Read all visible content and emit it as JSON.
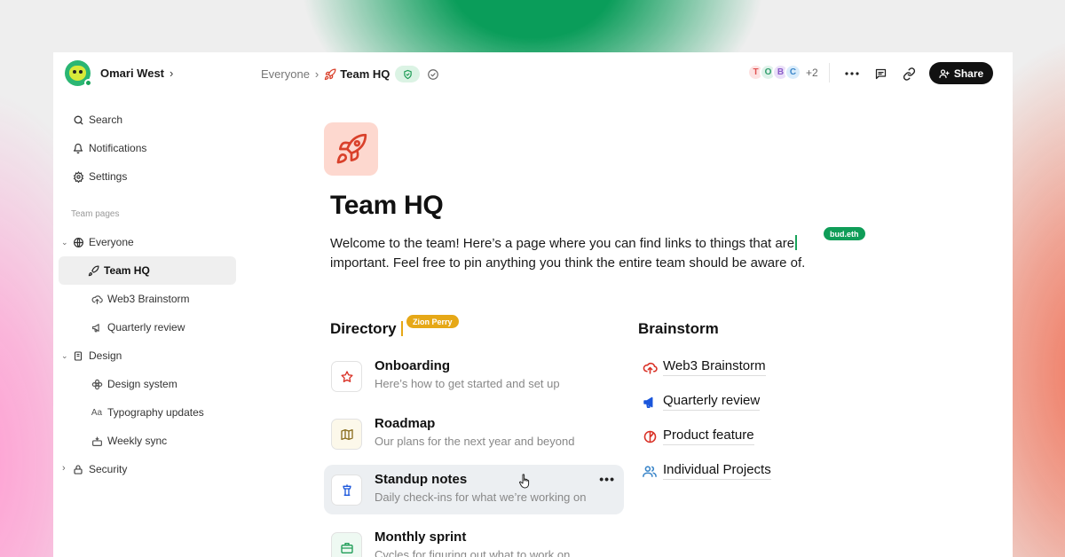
{
  "user": {
    "name": "Omari West"
  },
  "breadcrumb": {
    "parent": "Everyone",
    "current": "Team HQ"
  },
  "collaborators": {
    "avatars": [
      {
        "initial": "T",
        "bg": "#fde2e2",
        "fg": "#e05252"
      },
      {
        "initial": "O",
        "bg": "#dff2ea",
        "fg": "#2e9d6a"
      },
      {
        "initial": "B",
        "bg": "#eadff8",
        "fg": "#8b5cc9"
      },
      {
        "initial": "C",
        "bg": "#d9ecfb",
        "fg": "#3b86c9"
      }
    ],
    "more": "+2"
  },
  "toolbar": {
    "share_label": "Share"
  },
  "sidebar": {
    "search": "Search",
    "notifications": "Notifications",
    "settings": "Settings",
    "section_caption": "Team pages",
    "everyone": "Everyone",
    "team_hq": "Team HQ",
    "web3": "Web3 Brainstorm",
    "quarterly": "Quarterly review",
    "design": "Design",
    "design_system": "Design system",
    "typography_prefix": "Aa",
    "typography": "Typography updates",
    "weekly": "Weekly sync",
    "security": "Security"
  },
  "page": {
    "title": "Team HQ",
    "desc_line1": "Welcome to the team! Here’s a page where you can find links to things that are",
    "desc_line2": "important. Feel free to pin anything you think the entire team should be aware of.",
    "tag_bud": "bud.eth",
    "tag_zion": "Zion Perry"
  },
  "directory": {
    "title": "Directory",
    "items": [
      {
        "title": "Onboarding",
        "subtitle": "Here’s how to get started and set up",
        "icon": "star-icon"
      },
      {
        "title": "Roadmap",
        "subtitle": "Our plans for the next year and beyond",
        "icon": "map-icon"
      },
      {
        "title": "Standup notes",
        "subtitle": "Daily check-ins for what we’re working on",
        "icon": "podium-icon"
      },
      {
        "title": "Monthly sprint",
        "subtitle": "Cycles for figuring out what to work on",
        "icon": "briefcase-icon"
      }
    ],
    "more": "•••"
  },
  "brainstorm": {
    "title": "Brainstorm",
    "items": [
      {
        "label": "Web3 Brainstorm",
        "icon": "cloud-upload-icon",
        "color": "#d93025"
      },
      {
        "label": "Quarterly review",
        "icon": "megaphone-icon",
        "color": "#1a56db"
      },
      {
        "label": "Product feature",
        "icon": "pie-icon",
        "color": "#d93025"
      },
      {
        "label": "Individual Projects",
        "icon": "people-icon",
        "color": "#3b86c9"
      }
    ]
  },
  "colors": {
    "accent_green": "#0f9d58",
    "accent_yellow": "#e6a817",
    "page_icon_bg": "#fdd8cf",
    "rocket": "#d9412b"
  }
}
